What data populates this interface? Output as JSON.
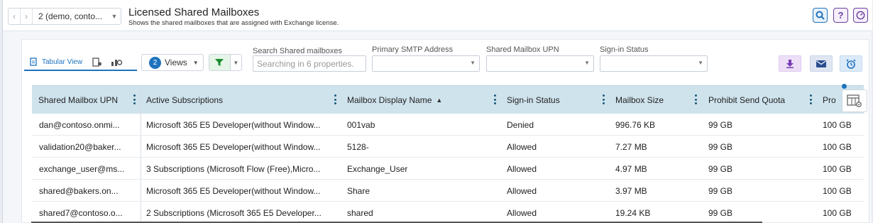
{
  "header": {
    "tenant": "2 (demo, conto...",
    "title": "Licensed Shared Mailboxes",
    "subtitle": "Shows the shared mailboxes that are assigned with Exchange license."
  },
  "toolbar": {
    "view_tab_tabular": "Tabular View",
    "views_count": "2",
    "views_label": "Views",
    "search_label": "Search Shared mailboxes",
    "search_placeholder": "Searching in 6 properties.",
    "smtp_label": "Primary SMTP Address",
    "upn_label": "Shared Mailbox UPN",
    "signin_label": "Sign-in Status"
  },
  "table": {
    "columns": [
      "Shared Mailbox UPN",
      "Active Subscriptions",
      "Mailbox Display Name",
      "Sign-in Status",
      "Mailbox Size",
      "Prohibit Send Quota",
      "Pro"
    ],
    "rows": [
      [
        "dan@contoso.onmi...",
        "Microsoft 365 E5 Developer(without Window...",
        "001vab",
        "Denied",
        "996.76 KB",
        "99 GB",
        "100 GB"
      ],
      [
        "validation20@baker...",
        "Microsoft 365 E5 Developer(without Window...",
        "5128-",
        "Allowed",
        "7.27 MB",
        "99 GB",
        "100 GB"
      ],
      [
        "exchange_user@ms...",
        "3 Subscriptions (Microsoft Flow (Free),Micro...",
        "Exchange_User",
        "Allowed",
        "4.97 MB",
        "99 GB",
        "100 GB"
      ],
      [
        "shared@bakers.on...",
        "Microsoft 365 E5 Developer(without Window...",
        "Share",
        "Allowed",
        "3.97 MB",
        "99 GB",
        "100 GB"
      ],
      [
        "shared7@contoso.o...",
        "2 Subscriptions (Microsoft 365 E5 Developer...",
        "shared",
        "Allowed",
        "19.24 KB",
        "99 GB",
        "100 GB"
      ]
    ]
  },
  "icons": {
    "back": "chevron-left-icon",
    "forward": "chevron-right-icon",
    "search": "search-icon",
    "help": "help-icon",
    "status": "gauge-icon",
    "filter": "filter-icon",
    "export": "download-icon",
    "email": "mail-icon",
    "schedule": "alarm-clock-icon",
    "columns": "column-settings-icon"
  },
  "colors": {
    "accent": "#1e73be",
    "header_bg": "#cfe3ed",
    "purple": "#6b3fa0",
    "green": "#1b8a2f"
  }
}
